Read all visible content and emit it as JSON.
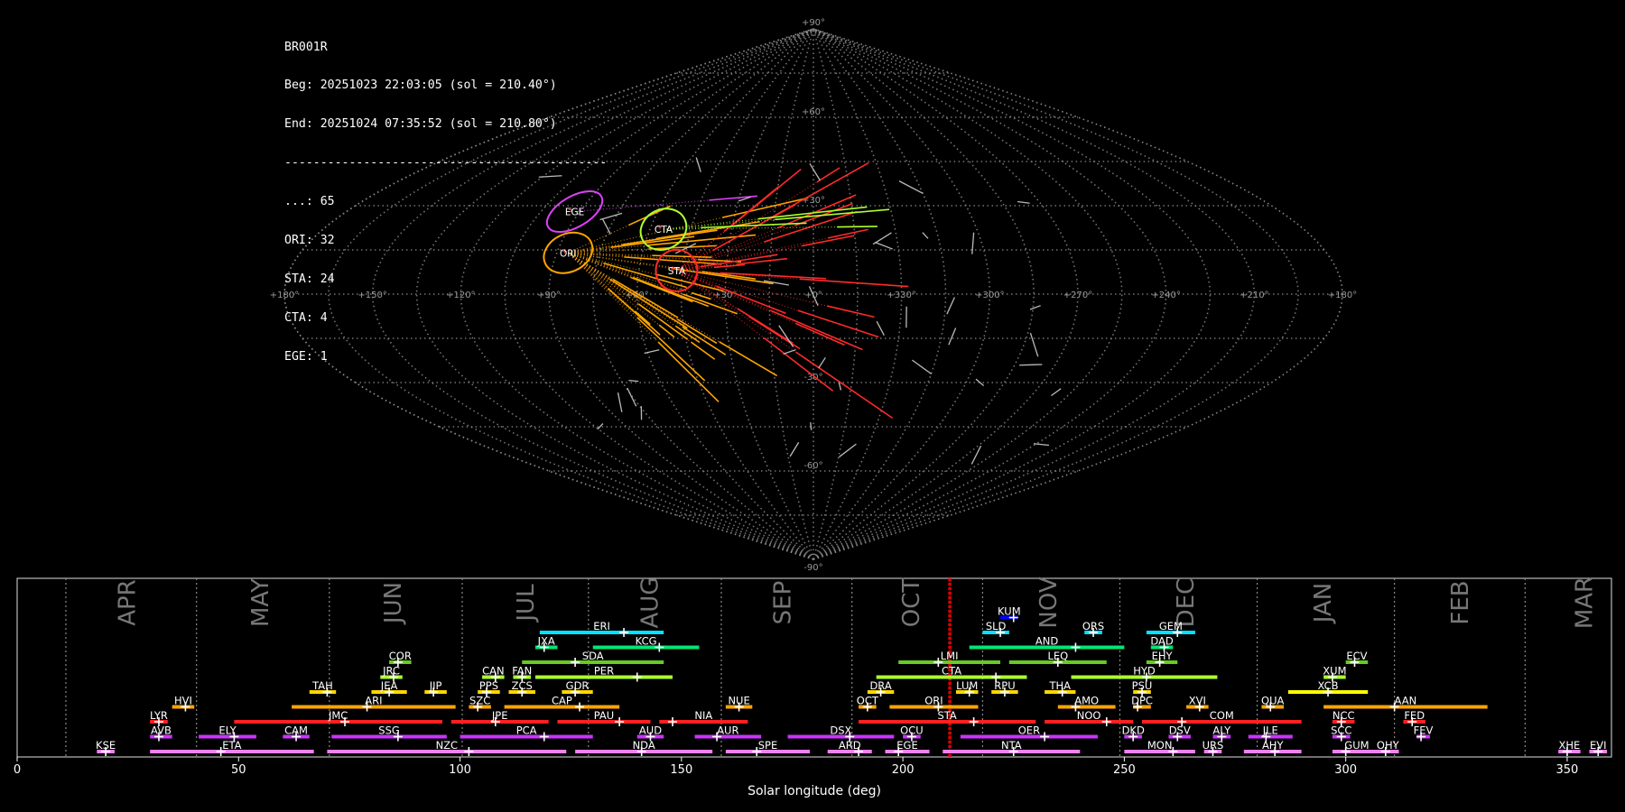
{
  "info": {
    "station": "BR001R",
    "begin": "Beg: 20251023 22:03:05 (sol = 210.40°)",
    "end": "End: 20251024 07:35:52 (sol = 210.80°)",
    "separator": "---------------------------------------------",
    "counts": [
      {
        "label": "...",
        "value": "65"
      },
      {
        "label": "ORI",
        "value": "32"
      },
      {
        "label": "STA",
        "value": "24"
      },
      {
        "label": "CTA",
        "value": "4"
      },
      {
        "label": "EGE",
        "value": "1"
      }
    ]
  },
  "sky_map": {
    "projection": "sinusoidal",
    "lat_labels": [
      "+90°",
      "+60°",
      "+30°",
      "-30°",
      "-60°",
      "-90°"
    ],
    "lat_values": [
      90,
      60,
      30,
      -30,
      -60,
      -90
    ],
    "lon_labels": [
      "+180°",
      "+150°",
      "+120°",
      "+90°",
      "+60°",
      "+30°",
      "+0°",
      "+330°",
      "+300°",
      "+270°",
      "+240°",
      "+210°",
      "+180°"
    ],
    "radiants": [
      {
        "name": "EGE",
        "ra": 92,
        "dec": 28,
        "color": "#e040fb"
      },
      {
        "name": "ORI",
        "ra": 86,
        "dec": 14,
        "color": "#ffa500"
      },
      {
        "name": "CTA",
        "ra": 55,
        "dec": 22,
        "color": "#adff2f"
      },
      {
        "name": "STA",
        "ra": 47,
        "dec": 8,
        "color": "#ff2a2a"
      }
    ],
    "colors": {
      "grid": "#888888",
      "sporadic": "#bbbbbb"
    }
  },
  "chart_data": {
    "type": "timeline",
    "xlabel": "Solar longitude (deg)",
    "xlim": [
      0,
      360
    ],
    "xticks": [
      0,
      50,
      100,
      150,
      200,
      250,
      300,
      350
    ],
    "current_sol": [
      210.4,
      210.8
    ],
    "month_boundaries": [
      11,
      40.5,
      70.5,
      100.5,
      129,
      159,
      188.5,
      218,
      249,
      280,
      311,
      340.5
    ],
    "months": [
      {
        "name": "APR",
        "sol": 25
      },
      {
        "name": "MAY",
        "sol": 55
      },
      {
        "name": "JUN",
        "sol": 85
      },
      {
        "name": "JUL",
        "sol": 115
      },
      {
        "name": "AUG",
        "sol": 143
      },
      {
        "name": "SEP",
        "sol": 173
      },
      {
        "name": "OCT",
        "sol": 202
      },
      {
        "name": "NOV",
        "sol": 233
      },
      {
        "name": "DEC",
        "sol": 264
      },
      {
        "name": "JAN",
        "sol": 295
      },
      {
        "name": "FEB",
        "sol": 326
      },
      {
        "name": "MAR",
        "sol": 354
      }
    ],
    "showers": [
      {
        "code": "KUM",
        "start": 222,
        "end": 226,
        "peak": 225,
        "row": 10,
        "color": "#0000ff"
      },
      {
        "code": "ERI",
        "start": 118,
        "end": 146,
        "peak": 137,
        "row": 9,
        "color": "#00e5ff"
      },
      {
        "code": "SLD",
        "start": 218,
        "end": 224,
        "peak": 222,
        "row": 9,
        "color": "#00e5ff"
      },
      {
        "code": "ORS",
        "start": 241,
        "end": 245,
        "peak": 243,
        "row": 9,
        "color": "#00e5ff"
      },
      {
        "code": "GEM",
        "start": 255,
        "end": 266,
        "peak": 262,
        "row": 9,
        "color": "#00e5ff"
      },
      {
        "code": "JXA",
        "start": 117,
        "end": 122,
        "peak": 119,
        "row": 8,
        "color": "#00e676"
      },
      {
        "code": "KCG",
        "start": 130,
        "end": 154,
        "peak": 145,
        "row": 8,
        "color": "#00e676"
      },
      {
        "code": "AND",
        "start": 215,
        "end": 250,
        "peak": 239,
        "row": 8,
        "color": "#00e676"
      },
      {
        "code": "DAD",
        "start": 256,
        "end": 261,
        "peak": 259,
        "row": 8,
        "color": "#00e676"
      },
      {
        "code": "COR",
        "start": 84,
        "end": 89,
        "peak": 86,
        "row": 7,
        "color": "#66cc22"
      },
      {
        "code": "SDA",
        "start": 114,
        "end": 146,
        "peak": 126,
        "row": 7,
        "color": "#66cc22"
      },
      {
        "code": "LMI",
        "start": 199,
        "end": 222,
        "peak": 208,
        "row": 7,
        "color": "#66cc22"
      },
      {
        "code": "LEQ",
        "start": 224,
        "end": 246,
        "peak": 235,
        "row": 7,
        "color": "#66cc22"
      },
      {
        "code": "EHY",
        "start": 255,
        "end": 262,
        "peak": 258,
        "row": 7,
        "color": "#66cc22"
      },
      {
        "code": "ECV",
        "start": 300,
        "end": 305,
        "peak": 302,
        "row": 7,
        "color": "#66cc22"
      },
      {
        "code": "JRC",
        "start": 82,
        "end": 87,
        "peak": 85,
        "row": 6,
        "color": "#adff2f"
      },
      {
        "code": "CAN",
        "start": 105,
        "end": 110,
        "peak": 108,
        "row": 6,
        "color": "#adff2f"
      },
      {
        "code": "FAN",
        "start": 112,
        "end": 116,
        "peak": 114,
        "row": 6,
        "color": "#adff2f"
      },
      {
        "code": "PER",
        "start": 117,
        "end": 148,
        "peak": 140,
        "row": 6,
        "color": "#adff2f"
      },
      {
        "code": "CTA",
        "start": 194,
        "end": 228,
        "peak": 221,
        "row": 6,
        "color": "#adff2f"
      },
      {
        "code": "HYD",
        "start": 238,
        "end": 271,
        "peak": 255,
        "row": 6,
        "color": "#adff2f"
      },
      {
        "code": "XUM",
        "start": 295,
        "end": 300,
        "peak": 297,
        "row": 6,
        "color": "#adff2f"
      },
      {
        "code": "TAH",
        "start": 66,
        "end": 72,
        "peak": 70,
        "row": 5,
        "color": "#ffd700"
      },
      {
        "code": "JEA",
        "start": 80,
        "end": 88,
        "peak": 84,
        "row": 5,
        "color": "#ffd700"
      },
      {
        "code": "JIP",
        "start": 92,
        "end": 97,
        "peak": 94,
        "row": 5,
        "color": "#ffd700"
      },
      {
        "code": "PPS",
        "start": 104,
        "end": 109,
        "peak": 106,
        "row": 5,
        "color": "#ffd700"
      },
      {
        "code": "ZCS",
        "start": 111,
        "end": 117,
        "peak": 114,
        "row": 5,
        "color": "#ffd700"
      },
      {
        "code": "GDR",
        "start": 123,
        "end": 130,
        "peak": 126,
        "row": 5,
        "color": "#ffd700"
      },
      {
        "code": "DRA",
        "start": 192,
        "end": 198,
        "peak": 195,
        "row": 5,
        "color": "#ffd700"
      },
      {
        "code": "LUM",
        "start": 212,
        "end": 217,
        "peak": 215,
        "row": 5,
        "color": "#ffd700"
      },
      {
        "code": "RPU",
        "start": 220,
        "end": 226,
        "peak": 223,
        "row": 5,
        "color": "#ffd700"
      },
      {
        "code": "THA",
        "start": 232,
        "end": 239,
        "peak": 236,
        "row": 5,
        "color": "#ffd700"
      },
      {
        "code": "PSU",
        "start": 252,
        "end": 256,
        "peak": 254,
        "row": 5,
        "color": "#ffd700"
      },
      {
        "code": "XCB",
        "start": 287,
        "end": 305,
        "peak": 296,
        "row": 5,
        "color": "#ffff00"
      },
      {
        "code": "HVI",
        "start": 35,
        "end": 40,
        "peak": 38,
        "row": 4,
        "color": "#ffa500"
      },
      {
        "code": "ARI",
        "start": 62,
        "end": 99,
        "peak": 79,
        "row": 4,
        "color": "#ffa500"
      },
      {
        "code": "SZC",
        "start": 102,
        "end": 107,
        "peak": 104,
        "row": 4,
        "color": "#ffa500"
      },
      {
        "code": "CAP",
        "start": 110,
        "end": 136,
        "peak": 127,
        "row": 4,
        "color": "#ffa500"
      },
      {
        "code": "NUE",
        "start": 160,
        "end": 166,
        "peak": 163,
        "row": 4,
        "color": "#ffa500"
      },
      {
        "code": "OCT",
        "start": 190,
        "end": 194,
        "peak": 192,
        "row": 4,
        "color": "#ffa500"
      },
      {
        "code": "ORI",
        "start": 197,
        "end": 217,
        "peak": 208,
        "row": 4,
        "color": "#ffa500"
      },
      {
        "code": "AMO",
        "start": 235,
        "end": 248,
        "peak": 239,
        "row": 4,
        "color": "#ffa500"
      },
      {
        "code": "DPC",
        "start": 252,
        "end": 256,
        "peak": 253,
        "row": 4,
        "color": "#ffa500"
      },
      {
        "code": "XVI",
        "start": 264,
        "end": 269,
        "peak": 267,
        "row": 4,
        "color": "#ffa500"
      },
      {
        "code": "QUA",
        "start": 281,
        "end": 286,
        "peak": 283,
        "row": 4,
        "color": "#ffa500"
      },
      {
        "code": "AAN",
        "start": 295,
        "end": 332,
        "peak": 311,
        "row": 4,
        "color": "#ffa500"
      },
      {
        "code": "LYR",
        "start": 30,
        "end": 34,
        "peak": 32,
        "row": 3,
        "color": "#ff2020"
      },
      {
        "code": "JMC",
        "start": 49,
        "end": 96,
        "peak": 74,
        "row": 3,
        "color": "#ff2020"
      },
      {
        "code": "JPE",
        "start": 98,
        "end": 120,
        "peak": 108,
        "row": 3,
        "color": "#ff2020"
      },
      {
        "code": "PAU",
        "start": 122,
        "end": 143,
        "peak": 136,
        "row": 3,
        "color": "#ff2020"
      },
      {
        "code": "NIA",
        "start": 145,
        "end": 165,
        "peak": 148,
        "row": 3,
        "color": "#ff2020"
      },
      {
        "code": "STA",
        "start": 190,
        "end": 230,
        "peak": 216,
        "row": 3,
        "color": "#ff2020"
      },
      {
        "code": "NOO",
        "start": 232,
        "end": 252,
        "peak": 246,
        "row": 3,
        "color": "#ff2020"
      },
      {
        "code": "COM",
        "start": 254,
        "end": 290,
        "peak": 263,
        "row": 3,
        "color": "#ff2020"
      },
      {
        "code": "NCC",
        "start": 297,
        "end": 302,
        "peak": 299,
        "row": 3,
        "color": "#ff2020"
      },
      {
        "code": "FED",
        "start": 313,
        "end": 318,
        "peak": 315,
        "row": 3,
        "color": "#ff2020"
      },
      {
        "code": "AVB",
        "start": 30,
        "end": 35,
        "peak": 32,
        "row": 2,
        "color": "#cc33ff"
      },
      {
        "code": "ELY",
        "start": 41,
        "end": 54,
        "peak": 49,
        "row": 2,
        "color": "#cc33ff"
      },
      {
        "code": "CAM",
        "start": 60,
        "end": 66,
        "peak": 63,
        "row": 2,
        "color": "#cc33ff"
      },
      {
        "code": "SSG",
        "start": 71,
        "end": 97,
        "peak": 86,
        "row": 2,
        "color": "#cc33ff"
      },
      {
        "code": "PCA",
        "start": 100,
        "end": 130,
        "peak": 119,
        "row": 2,
        "color": "#cc33ff"
      },
      {
        "code": "AUD",
        "start": 140,
        "end": 146,
        "peak": 143,
        "row": 2,
        "color": "#cc33ff"
      },
      {
        "code": "AUR",
        "start": 153,
        "end": 168,
        "peak": 158,
        "row": 2,
        "color": "#cc33ff"
      },
      {
        "code": "DSX",
        "start": 174,
        "end": 198,
        "peak": 188,
        "row": 2,
        "color": "#cc33ff"
      },
      {
        "code": "OCU",
        "start": 200,
        "end": 204,
        "peak": 202,
        "row": 2,
        "color": "#cc33ff"
      },
      {
        "code": "OER",
        "start": 213,
        "end": 244,
        "peak": 232,
        "row": 2,
        "color": "#cc33ff"
      },
      {
        "code": "DKD",
        "start": 250,
        "end": 254,
        "peak": 252,
        "row": 2,
        "color": "#cc33ff"
      },
      {
        "code": "DSV",
        "start": 260,
        "end": 265,
        "peak": 262,
        "row": 2,
        "color": "#cc33ff"
      },
      {
        "code": "ALY",
        "start": 270,
        "end": 274,
        "peak": 272,
        "row": 2,
        "color": "#cc33ff"
      },
      {
        "code": "JLE",
        "start": 278,
        "end": 288,
        "peak": 282,
        "row": 2,
        "color": "#cc33ff"
      },
      {
        "code": "SCC",
        "start": 297,
        "end": 301,
        "peak": 299,
        "row": 2,
        "color": "#cc33ff"
      },
      {
        "code": "FEV",
        "start": 316,
        "end": 319,
        "peak": 317,
        "row": 2,
        "color": "#cc33ff"
      },
      {
        "code": "KSE",
        "start": 18,
        "end": 22,
        "peak": 20,
        "row": 1,
        "color": "#ee82ee"
      },
      {
        "code": "ETA",
        "start": 30,
        "end": 67,
        "peak": 46,
        "row": 1,
        "color": "#ee82ee"
      },
      {
        "code": "NZC",
        "start": 70,
        "end": 124,
        "peak": 102,
        "row": 1,
        "color": "#ee82ee"
      },
      {
        "code": "NDA",
        "start": 126,
        "end": 157,
        "peak": 141,
        "row": 1,
        "color": "#ee82ee"
      },
      {
        "code": "SPE",
        "start": 160,
        "end": 179,
        "peak": 167,
        "row": 1,
        "color": "#ee82ee"
      },
      {
        "code": "ARD",
        "start": 183,
        "end": 193,
        "peak": 190,
        "row": 1,
        "color": "#ee82ee"
      },
      {
        "code": "EGE",
        "start": 196,
        "end": 206,
        "peak": 199,
        "row": 1,
        "color": "#ee82ee"
      },
      {
        "code": "NTA",
        "start": 209,
        "end": 240,
        "peak": 225,
        "row": 1,
        "color": "#ee82ee"
      },
      {
        "code": "MON",
        "start": 250,
        "end": 266,
        "peak": 261,
        "row": 1,
        "color": "#ee82ee"
      },
      {
        "code": "URS",
        "start": 268,
        "end": 272,
        "peak": 270,
        "row": 1,
        "color": "#ee82ee"
      },
      {
        "code": "AHY",
        "start": 277,
        "end": 290,
        "peak": 284,
        "row": 1,
        "color": "#ee82ee"
      },
      {
        "code": "GUM",
        "start": 297,
        "end": 308,
        "peak": 300,
        "row": 1,
        "color": "#ee82ee"
      },
      {
        "code": "OHY",
        "start": 307,
        "end": 312,
        "peak": 309,
        "row": 1,
        "color": "#ee82ee"
      },
      {
        "code": "XHE",
        "start": 348,
        "end": 353,
        "peak": 350,
        "row": 1,
        "color": "#ee82ee"
      },
      {
        "code": "EVI",
        "start": 355,
        "end": 359,
        "peak": 357,
        "row": 1,
        "color": "#ee82ee"
      }
    ]
  }
}
